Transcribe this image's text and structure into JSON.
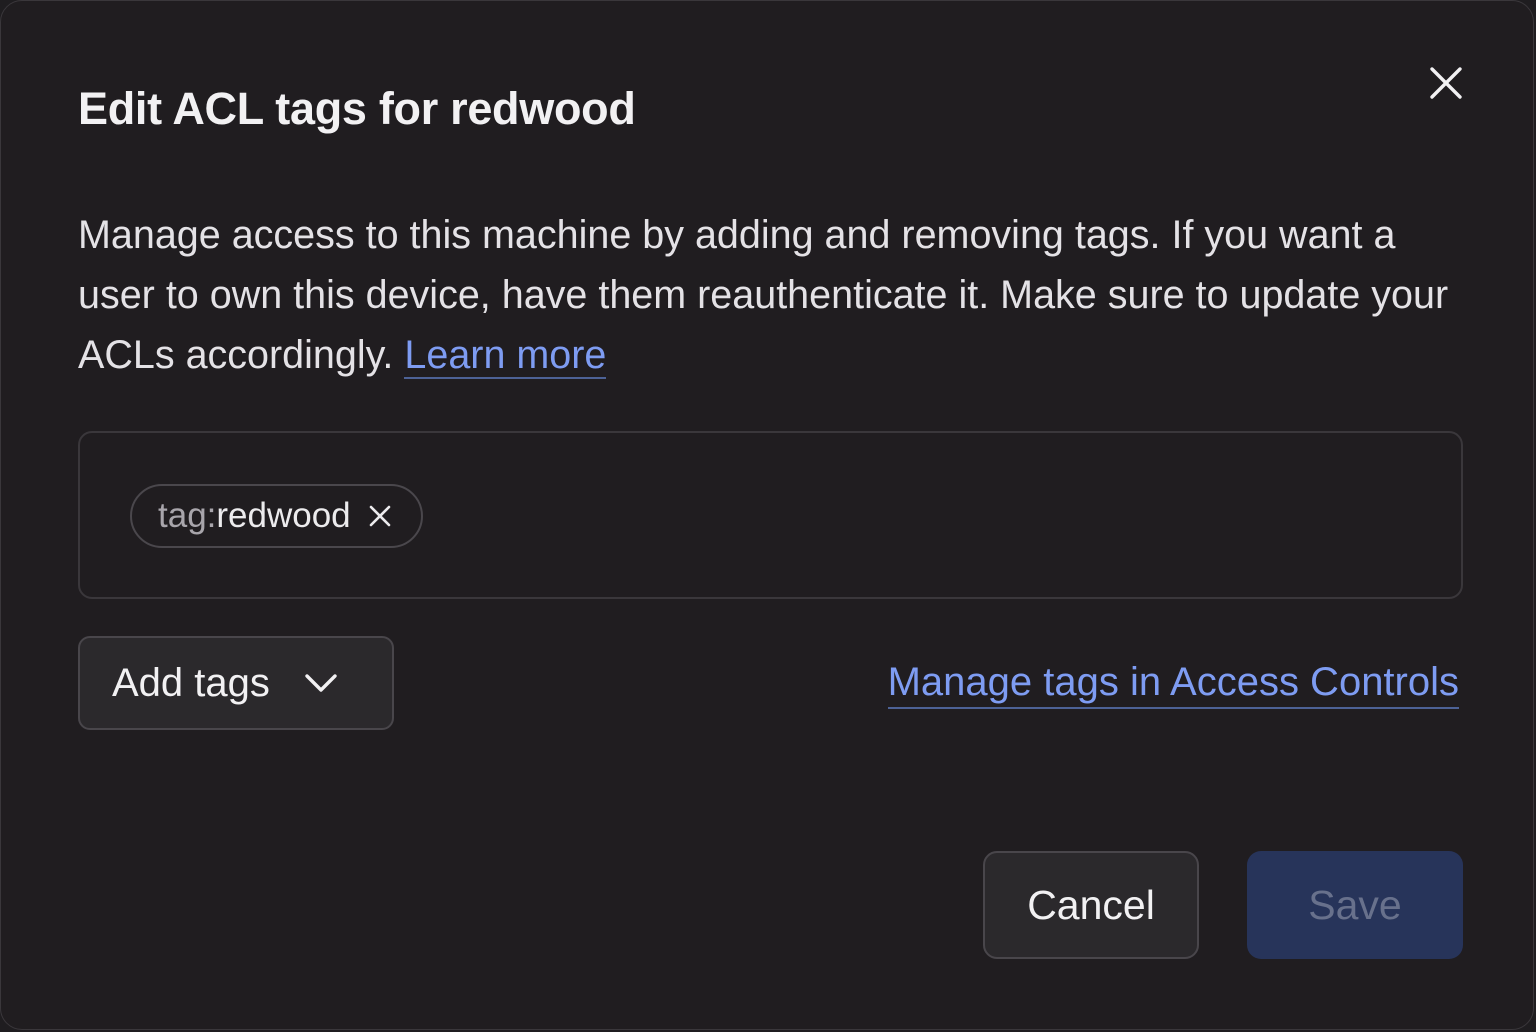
{
  "dialog": {
    "title": "Edit ACL tags for redwood",
    "description": "Manage access to this machine by adding and removing tags. If you want a user to own this device, have them reauthenticate it. Make sure to update your ACLs accordingly.",
    "learn_more_label": "Learn more",
    "close_icon": "close-icon"
  },
  "tags": [
    {
      "prefix": "tag:",
      "name": "redwood",
      "remove_icon": "close-icon"
    }
  ],
  "controls": {
    "add_tags_label": "Add tags",
    "add_tags_icon": "chevron-down-icon",
    "manage_link_label": "Manage tags in Access Controls"
  },
  "footer": {
    "cancel_label": "Cancel",
    "save_label": "Save",
    "save_disabled": true
  },
  "colors": {
    "background": "#201d20",
    "link": "#7e9cf2",
    "save_button": "#27345a",
    "save_text": "#68718c"
  }
}
